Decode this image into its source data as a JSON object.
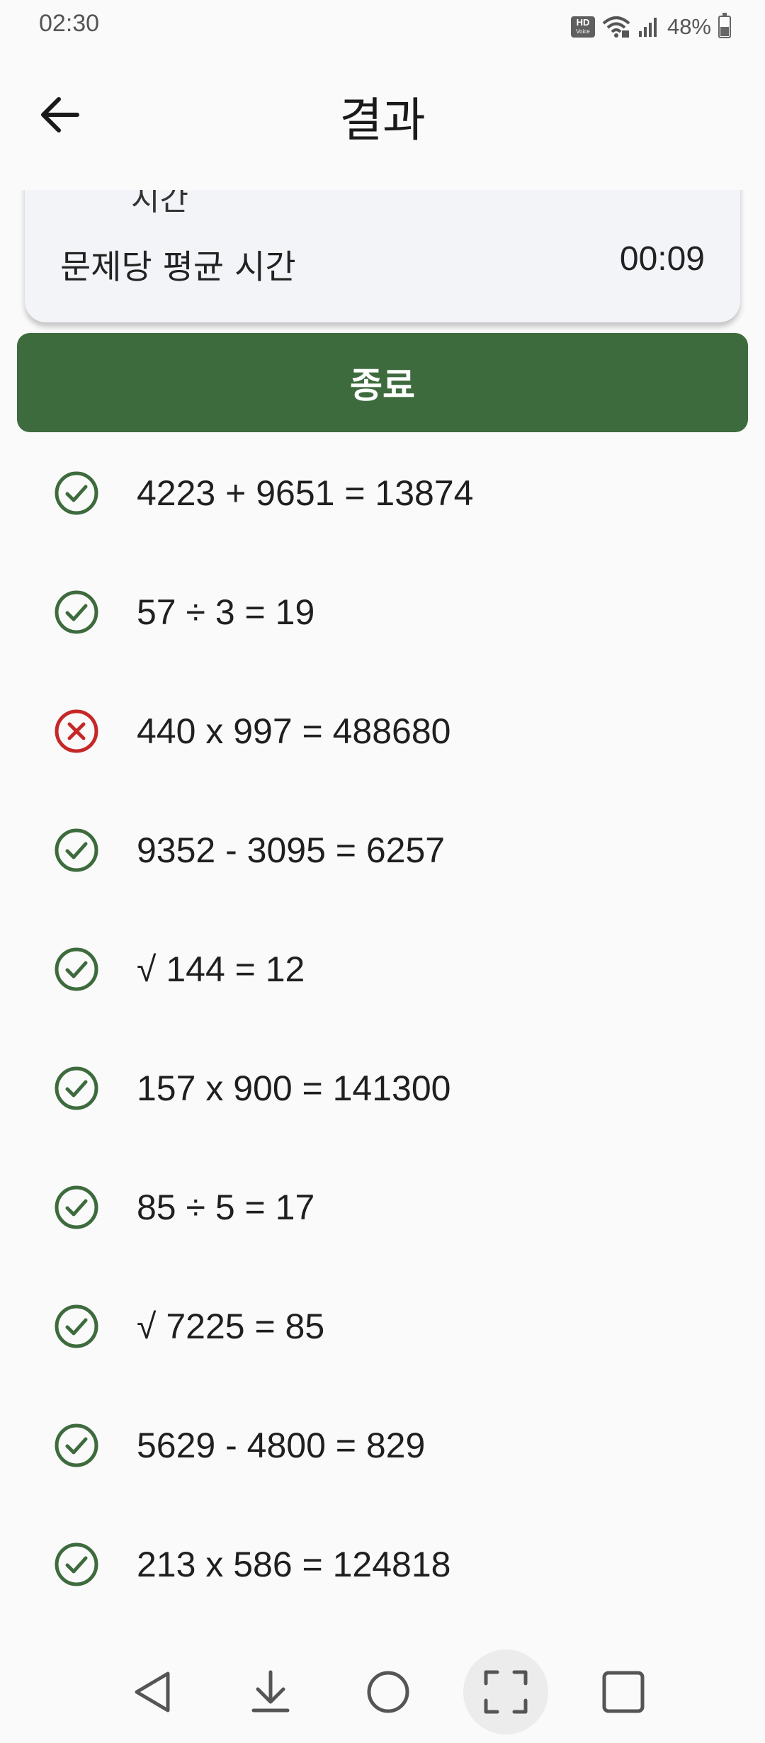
{
  "status_bar": {
    "time": "02:30",
    "battery": "48%",
    "icons": [
      "hd-voice-icon",
      "wifi-icon",
      "signal-icon",
      "battery-icon"
    ]
  },
  "app_bar": {
    "title": "결과",
    "back_icon": "arrow-left-icon"
  },
  "summary": {
    "hidden_label": "시간",
    "avg_label": "문제당 평균 시간",
    "avg_value": "00:09"
  },
  "end_button": {
    "label": "종료"
  },
  "problems": [
    {
      "text": "4223 + 9651 = 13874",
      "status": "correct"
    },
    {
      "text": "57 ÷ 3 = 19",
      "status": "correct"
    },
    {
      "text": "440 x 997 = 488680",
      "status": "wrong"
    },
    {
      "text": "9352 - 3095 = 6257",
      "status": "correct"
    },
    {
      "text": "√ 144 = 12",
      "status": "correct"
    },
    {
      "text": "157 x 900 = 141300",
      "status": "correct"
    },
    {
      "text": "85 ÷ 5 = 17",
      "status": "correct"
    },
    {
      "text": "√ 7225 = 85",
      "status": "correct"
    },
    {
      "text": "5629 - 4800 = 829",
      "status": "correct"
    },
    {
      "text": "213 x 586 = 124818",
      "status": "correct"
    }
  ],
  "colors": {
    "primary": "#3d6b3d",
    "correct": "#3d6b3d",
    "wrong": "#c62828",
    "card": "#f3f4f8",
    "background": "#fafafa"
  },
  "nav_bar": {
    "buttons": [
      "back-nav-icon",
      "download-nav-icon",
      "home-nav-icon",
      "screenshot-nav-icon",
      "recents-nav-icon"
    ]
  }
}
